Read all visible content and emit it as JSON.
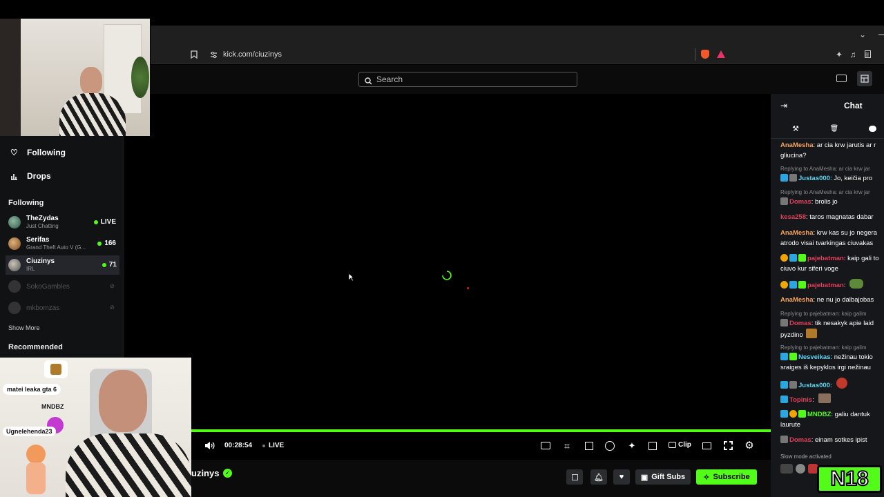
{
  "browser": {
    "url": "kick.com/ciuzinys"
  },
  "header": {
    "search_placeholder": "Search"
  },
  "sidebar": {
    "nav": [
      {
        "label": "Following",
        "icon": "heart-icon"
      },
      {
        "label": "Drops",
        "icon": "drops-icon"
      }
    ],
    "following_title": "Following",
    "channels": [
      {
        "name": "TheZydas",
        "category": "Just Chatting",
        "viewers": "LIVE"
      },
      {
        "name": "Serifas",
        "category": "Grand Theft Auto V (G...",
        "viewers": "166"
      },
      {
        "name": "Ciuzinys",
        "category": "IRL",
        "viewers": "71"
      },
      {
        "name": "SokoGambles"
      },
      {
        "name": "mkbomzas"
      }
    ],
    "show_more": "Show More",
    "recommended_title": "Recommended"
  },
  "overlay": {
    "chat_bubble_1": "matei leaka gta 6",
    "chat_name_1": "MNDBZ",
    "chat_name_2": "Ugnelehenda23",
    "brand_badge": "N18"
  },
  "player": {
    "time": "00:28:54",
    "live_label": "LIVE",
    "clip_label": "Clip",
    "channel_name": "uzinys",
    "gift_subs_label": "Gift Subs",
    "subscribe_label": "Subscribe"
  },
  "chat": {
    "title": "Chat",
    "messages": [
      {
        "reply": "",
        "user": "AnaMesha",
        "color": "#f5a25d",
        "text": ": ar cia krw jarutis ar r gliucina?"
      },
      {
        "reply": "Replying to AnaMesha: ar cia krw jar",
        "user": "Justas000",
        "color": "#5bd6f5",
        "text": ": Jo, keičia pro"
      },
      {
        "reply": "Replying to AnaMesha: ar cia krw jar",
        "user": "Domas",
        "color": "#e0405a",
        "text": ": brolis jo"
      },
      {
        "reply": "",
        "user": "kesa258",
        "color": "#e0405a",
        "text": ": taros magnatas dabar"
      },
      {
        "reply": "",
        "user": "AnaMesha",
        "color": "#f5a25d",
        "text": ": krw kas su jo negera atrodo visai tvarkingas ciuvakas"
      },
      {
        "reply": "",
        "user": "pajebatman",
        "color": "#e0405a",
        "text": ": kaip gali to ciuvo kur siferi voge"
      },
      {
        "reply": "",
        "user": "pajebatman",
        "color": "#e0405a",
        "text": ":"
      },
      {
        "reply": "",
        "user": "AnaMesha",
        "color": "#f5a25d",
        "text": ": ne nu jo dalbajobas"
      },
      {
        "reply": "Replying to pajebatman: kaip galim",
        "user": "Domas",
        "color": "#e0405a",
        "text": ": tik nesakyk apie laid pyzdino"
      },
      {
        "reply": "Replying to pajebatman: kaip galim",
        "user": "Nesveikas",
        "color": "#5bd6f5",
        "text": ": nežinau tokio sraiges iš kepyklos irgi nežinau"
      },
      {
        "reply": "",
        "user": "Justas000",
        "color": "#5bd6f5",
        "text": ":"
      },
      {
        "reply": "",
        "user": "Topinis",
        "color": "#e0405a",
        "text": ":"
      },
      {
        "reply": "",
        "user": "MNDBZ",
        "color": "#53fc18",
        "text": ": galiu dantuk laurute"
      },
      {
        "reply": "",
        "user": "Domas",
        "color": "#e0405a",
        "text": ": einam sotkes ipist"
      }
    ],
    "slow_mode": "Slow mode activated"
  }
}
